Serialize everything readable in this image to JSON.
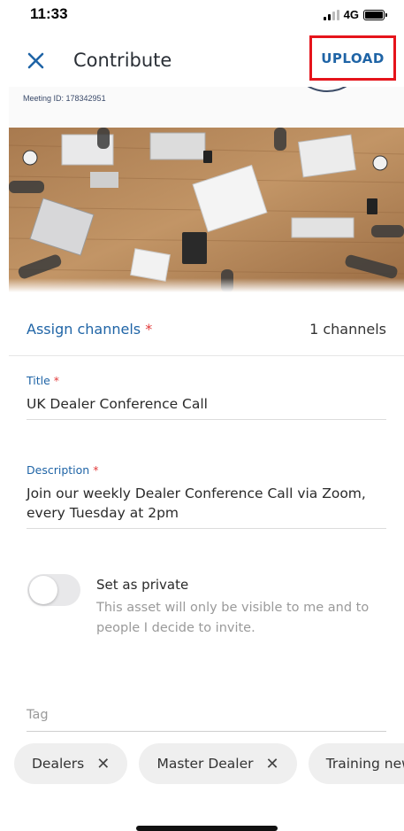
{
  "status_bar": {
    "time": "11:33",
    "network": "4G"
  },
  "header": {
    "title": "Contribute",
    "upload_label": "UPLOAD",
    "close_icon": "close-icon"
  },
  "banner": {
    "meeting_id": "Meeting ID: 178342951"
  },
  "channels": {
    "label": "Assign channels",
    "required": "*",
    "count": "1 channels"
  },
  "title_field": {
    "label": "Title",
    "required": "*",
    "value": "UK Dealer Conference Call"
  },
  "description_field": {
    "label": "Description",
    "required": "*",
    "value": "Join our weekly Dealer Conference Call via Zoom, every Tuesday at 2pm"
  },
  "private": {
    "title": "Set as private",
    "description": "This asset will only be visible to me and to people I decide to invite.",
    "enabled": false
  },
  "tag": {
    "placeholder": "Tag",
    "chips": [
      {
        "label": "Dealers"
      },
      {
        "label": "Master Dealer"
      },
      {
        "label": "Training news"
      }
    ]
  },
  "colors": {
    "accent": "#1f64a6",
    "required": "#e23b3b",
    "highlight": "#e5141b"
  }
}
